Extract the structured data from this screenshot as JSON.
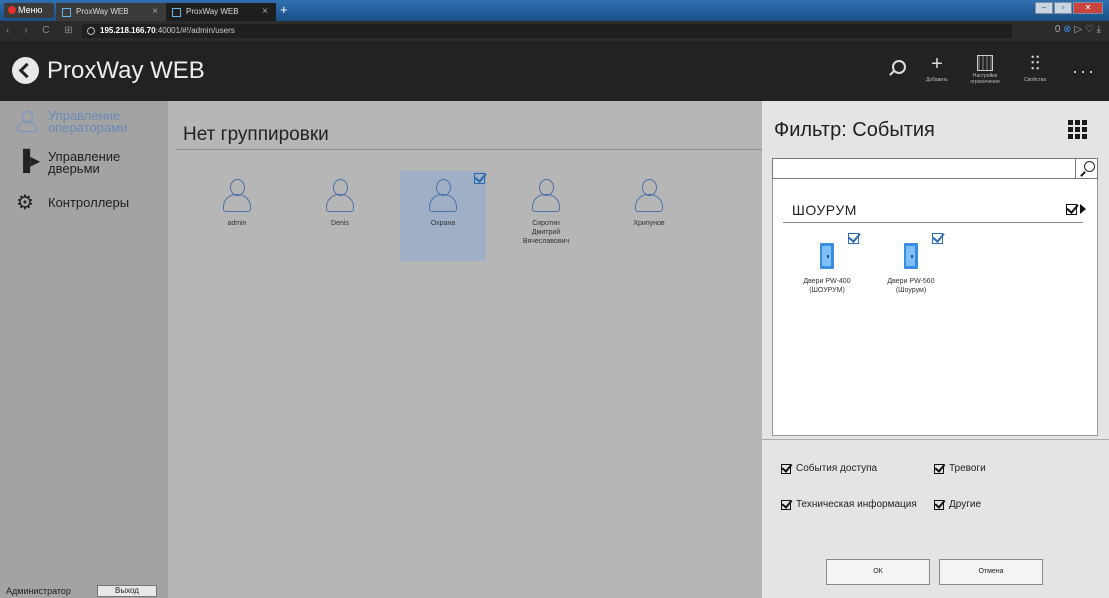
{
  "browser": {
    "menu_label": "Меню",
    "tabs": [
      {
        "title": "ProxWay WEB",
        "close": "×"
      },
      {
        "title": "ProxWay WEB",
        "close": "×"
      }
    ],
    "new_tab": "+",
    "url_host": "195.218.166.70",
    "url_rest": ":40001/#!/admin/users",
    "nav_arrows": "‹ › C ⊞",
    "right_badge": "0",
    "window_controls": [
      "‒",
      "▫",
      "✕"
    ]
  },
  "app": {
    "title": "ProxWay WEB",
    "header_buttons": {
      "add": "Добавить",
      "limit_settings": "Настройки ограничения",
      "properties": "Свойства",
      "more": "···"
    }
  },
  "sidebar": {
    "items": [
      {
        "label": "Управление операторами",
        "icon": "operators-icon",
        "active": true
      },
      {
        "label": "Управление дверьми",
        "icon": "door-exit-icon",
        "active": false
      },
      {
        "label": "Контроллеры",
        "icon": "gear-icon",
        "active": false
      }
    ],
    "user_label": "Администратор",
    "exit_label": "Выход"
  },
  "main": {
    "title": "Нет группировки",
    "operators": [
      {
        "name": "admin",
        "selected": false
      },
      {
        "name": "Denis",
        "selected": false
      },
      {
        "name": "Охрана",
        "selected": true
      },
      {
        "name": "Сиротин Дмитрий Вячеславович",
        "selected": false
      },
      {
        "name": "Хрипунов",
        "selected": false
      }
    ]
  },
  "filter": {
    "title": "Фильтр: События",
    "search_placeholder": "",
    "group": {
      "name": "ШОУРУМ",
      "checked": true,
      "devices": [
        {
          "name": "Двери PW-400 (ШОУРУМ)",
          "checked": true
        },
        {
          "name": "Двери PW-560 (Шоурум)",
          "checked": true
        }
      ]
    },
    "options": [
      {
        "label": "События доступа",
        "checked": true
      },
      {
        "label": "Тревоги",
        "checked": true
      },
      {
        "label": "Техническая информация",
        "checked": true
      },
      {
        "label": "Другие",
        "checked": true
      }
    ],
    "ok_label": "ОК",
    "cancel_label": "Отмена"
  },
  "colors": {
    "accent_blue": "#2d6cb0",
    "header_bg": "#222222",
    "sidebar_bg": "#a3a3a3",
    "panel_bg": "#e4e4e4",
    "selection_bg": "#9fb0c6"
  }
}
